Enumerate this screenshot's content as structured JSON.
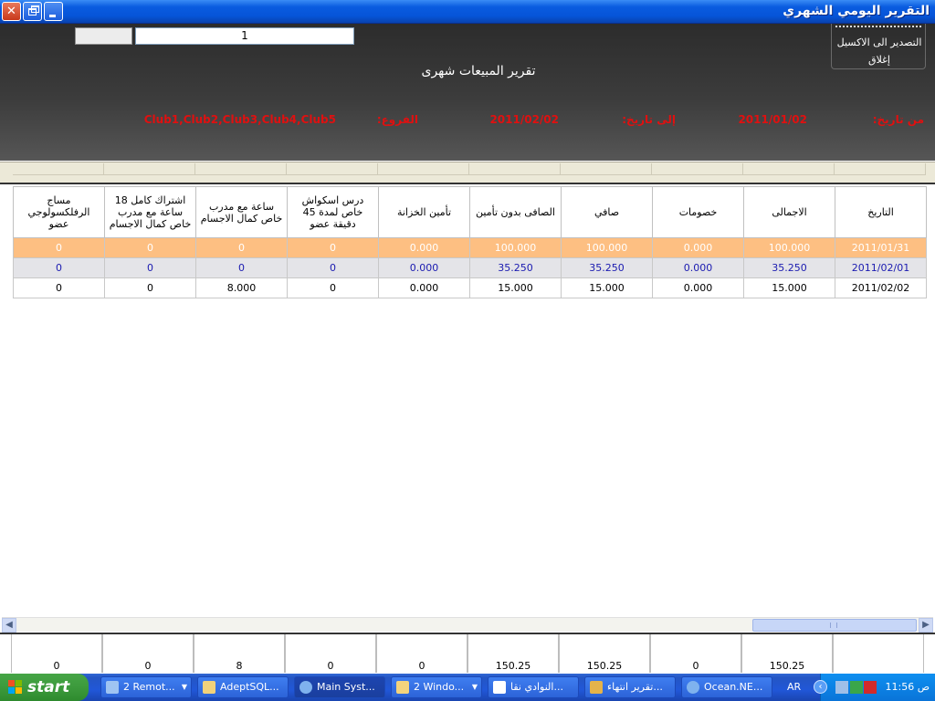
{
  "window": {
    "title": "التقرير اليومي الشهري",
    "buttons": {
      "close": "✕",
      "min": "_"
    }
  },
  "menu": {
    "export_excel": "التصدير الى الاكسيل",
    "close": "إغلاق"
  },
  "search": {
    "value": "1"
  },
  "report": {
    "title": "تقرير المبيعات شهرى",
    "from_label": "من تاريخ:",
    "from_value": "2011/01/02",
    "to_label": "إلى تاريخ:",
    "to_value": "2011/02/02",
    "branch_label": "الفروع:",
    "branch_value": "Club1,Club2,Club3,Club4,Club5"
  },
  "grid": {
    "columns": [
      "التاريخ",
      "الاجمالى",
      "خصومات",
      "صافي",
      "الصافى بدون تأمين",
      "تأمين الخزانة",
      "درس اسكواش خاص لمدة 45 دقيقة عضو",
      "ساعة مع مدرب خاص كمال الاجسام",
      "اشتراك كامل 18 ساعة مع مدرب خاص كمال الاجسام",
      "مساج الرفلكسولوجي عضو"
    ],
    "rows": [
      [
        "2011/01/31",
        "100.000",
        "0.000",
        "100.000",
        "100.000",
        "0.000",
        "0",
        "0",
        "0",
        "0"
      ],
      [
        "2011/02/01",
        "35.250",
        "0.000",
        "35.250",
        "35.250",
        "0.000",
        "0",
        "0",
        "0",
        "0"
      ],
      [
        "2011/02/02",
        "15.000",
        "0.000",
        "15.000",
        "15.000",
        "0.000",
        "0",
        "8.000",
        "0",
        "0"
      ]
    ],
    "selected_row": 0
  },
  "totals": [
    "",
    "150.25",
    "0",
    "150.25",
    "150.25",
    "0",
    "0",
    "8",
    "0",
    "0"
  ],
  "colors": {
    "selected_row": "#fdbf82",
    "alt_row": "#e4e4e8",
    "alt_text": "#1a1ab0",
    "header_red": "#e01010"
  },
  "taskbar": {
    "start": "start",
    "items": [
      {
        "label": "2 Remot...",
        "icon": "remote-desktop-icon",
        "arrow": true
      },
      {
        "label": "AdeptSQL...",
        "icon": "database-icon",
        "arrow": false
      },
      {
        "label": "Main Syst...",
        "icon": "globe-icon",
        "arrow": false
      },
      {
        "label": "2 Windo...",
        "icon": "folder-icon",
        "arrow": true
      },
      {
        "label": "النوادي نقا...",
        "icon": "document-icon",
        "arrow": false
      },
      {
        "label": "تقرير انتهاء...",
        "icon": "app-icon",
        "arrow": false
      },
      {
        "label": "Ocean.NE...",
        "icon": "globe-icon",
        "arrow": false
      }
    ],
    "language": "AR",
    "clock": "ص 11:56"
  }
}
